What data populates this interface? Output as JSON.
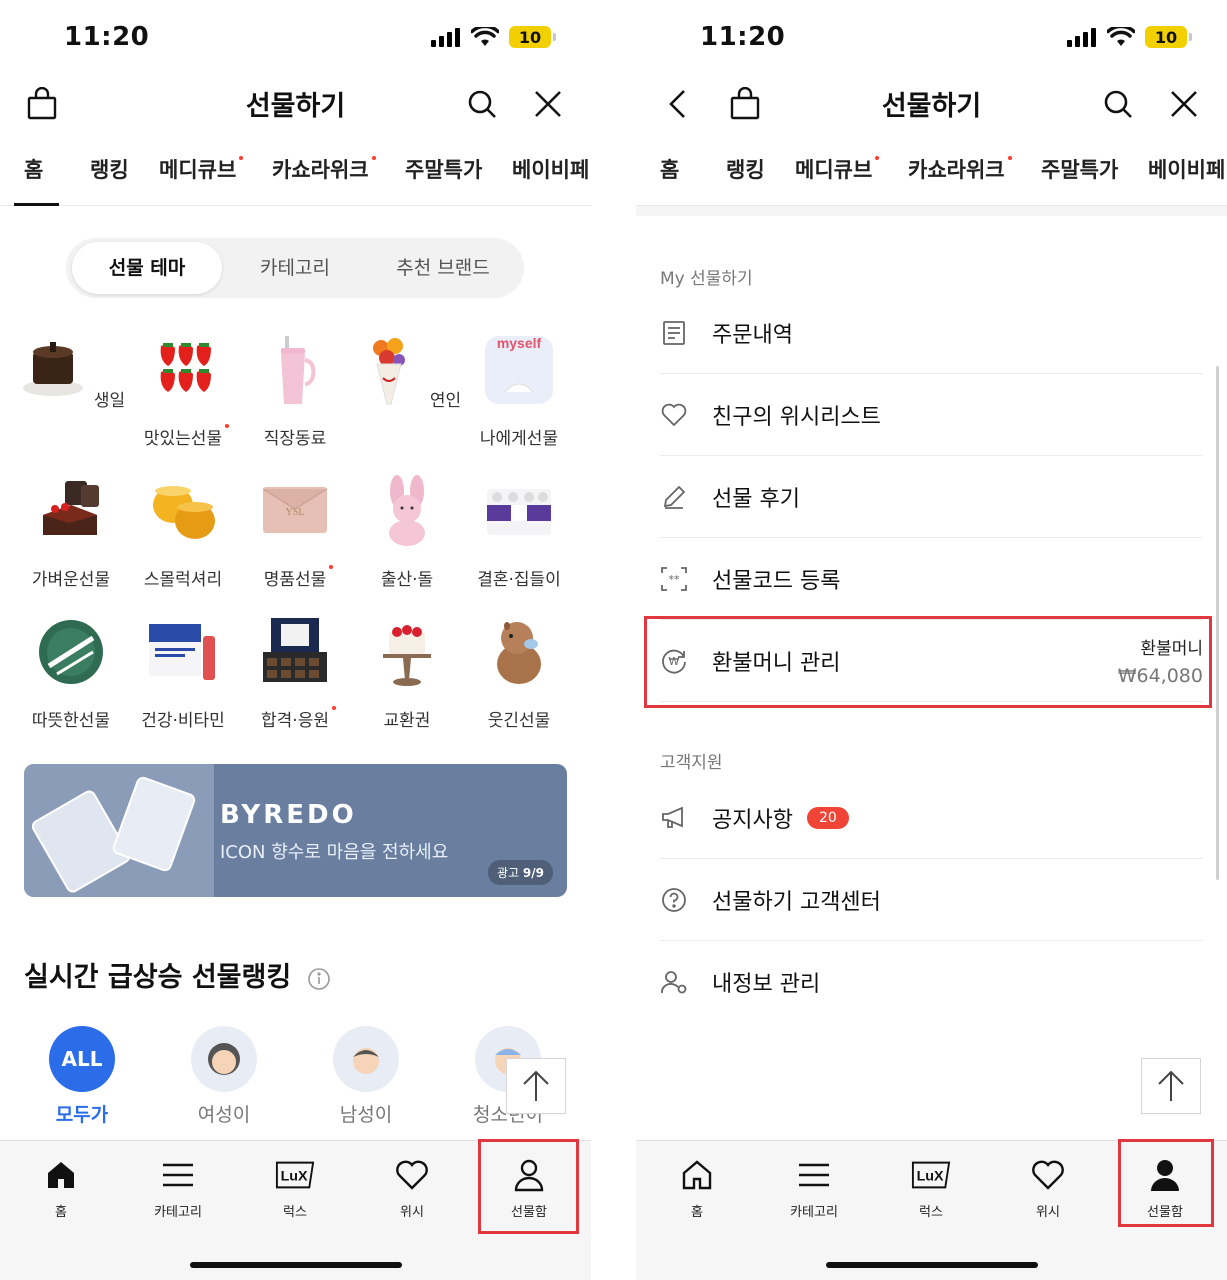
{
  "status": {
    "time": "11:20",
    "battery": "10"
  },
  "header": {
    "title": "선물하기"
  },
  "tabs": [
    "홈",
    "랭킹",
    "메디큐브",
    "카쇼라위크",
    "주말특가",
    "베이비페"
  ],
  "segmented": [
    "선물 테마",
    "카테고리",
    "추천 브랜드"
  ],
  "themes": [
    "생일",
    "맛있는선물",
    "직장동료",
    "연인",
    "나에게선물",
    "가벼운선물",
    "스몰럭셔리",
    "명품선물",
    "출산·돌",
    "결혼·집들이",
    "따뜻한선물",
    "건강·비타민",
    "합격·응원",
    "교환권",
    "웃긴선물"
  ],
  "theme_images": {
    "myself": "myself"
  },
  "banner": {
    "brand": "BYREDO",
    "text": "ICON 향수로 마음을 전하세요",
    "badge_prefix": "광고",
    "badge_count": "9/9"
  },
  "ranking": {
    "title": "실시간 급상승 선물랭킹",
    "all_chip": "ALL",
    "audiences": [
      "모두가",
      "여성이",
      "남성이",
      "청소년이"
    ]
  },
  "bottom_nav": [
    "홈",
    "카테고리",
    "럭스",
    "위시",
    "선물함"
  ],
  "lux_logo": "LuX",
  "my_menu": {
    "section1": "My 선물하기",
    "items": [
      "주문내역",
      "친구의 위시리스트",
      "선물 후기",
      "선물코드 등록",
      "환불머니 관리"
    ],
    "refund_label": "환불머니",
    "refund_value": "₩64,080",
    "section2": "고객지원",
    "support": [
      "공지사항",
      "선물하기 고객센터",
      "내정보 관리"
    ],
    "notice_badge": "20"
  },
  "colors": {
    "accent_blue": "#2b6de8",
    "highlight_red": "#e0383e",
    "badge_red": "#f04436"
  }
}
